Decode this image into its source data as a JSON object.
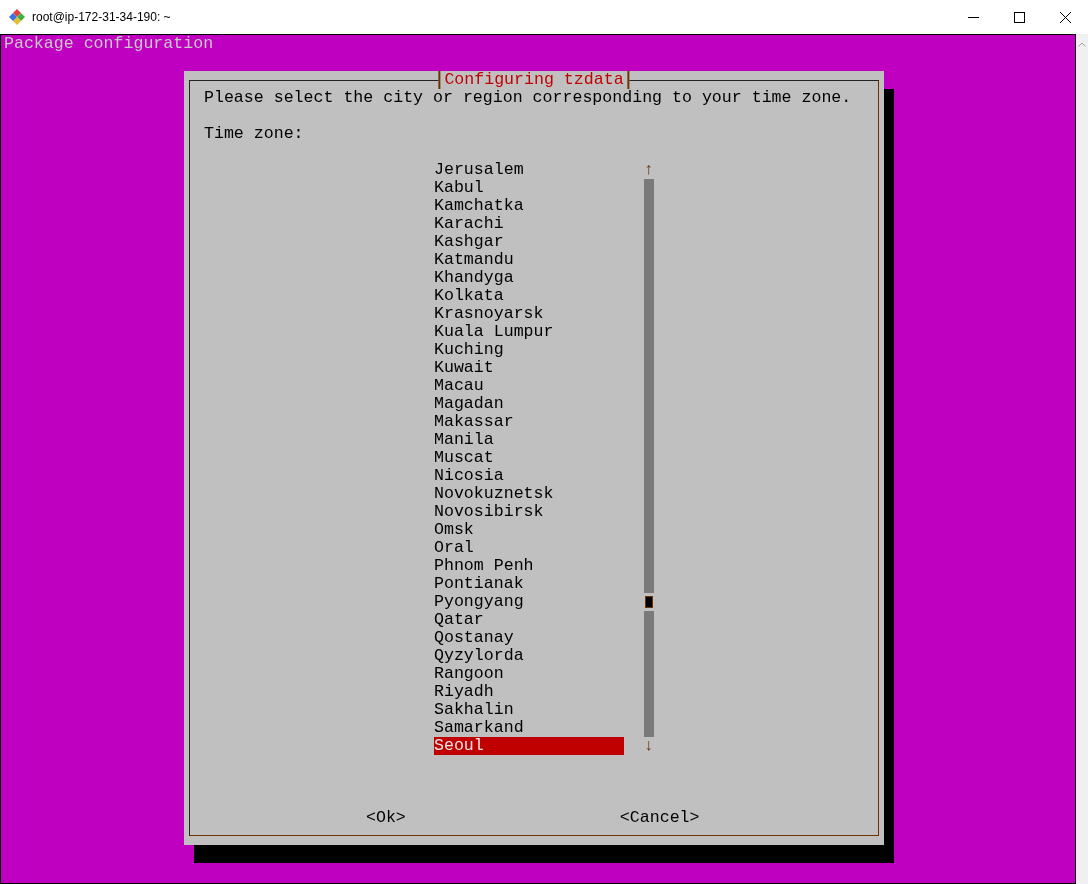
{
  "window": {
    "title": "root@ip-172-31-34-190: ~"
  },
  "terminal": {
    "header": "Package configuration"
  },
  "dialog": {
    "title": "Configuring tzdata",
    "prompt": "Please select the city or region corresponding to your time zone.",
    "list_label": "Time zone:",
    "items": [
      {
        "label": "Jerusalem",
        "selected": false
      },
      {
        "label": "Kabul",
        "selected": false
      },
      {
        "label": "Kamchatka",
        "selected": false
      },
      {
        "label": "Karachi",
        "selected": false
      },
      {
        "label": "Kashgar",
        "selected": false
      },
      {
        "label": "Katmandu",
        "selected": false
      },
      {
        "label": "Khandyga",
        "selected": false
      },
      {
        "label": "Kolkata",
        "selected": false
      },
      {
        "label": "Krasnoyarsk",
        "selected": false
      },
      {
        "label": "Kuala Lumpur",
        "selected": false
      },
      {
        "label": "Kuching",
        "selected": false
      },
      {
        "label": "Kuwait",
        "selected": false
      },
      {
        "label": "Macau",
        "selected": false
      },
      {
        "label": "Magadan",
        "selected": false
      },
      {
        "label": "Makassar",
        "selected": false
      },
      {
        "label": "Manila",
        "selected": false
      },
      {
        "label": "Muscat",
        "selected": false
      },
      {
        "label": "Nicosia",
        "selected": false
      },
      {
        "label": "Novokuznetsk",
        "selected": false
      },
      {
        "label": "Novosibirsk",
        "selected": false
      },
      {
        "label": "Omsk",
        "selected": false
      },
      {
        "label": "Oral",
        "selected": false
      },
      {
        "label": "Phnom Penh",
        "selected": false
      },
      {
        "label": "Pontianak",
        "selected": false
      },
      {
        "label": "Pyongyang",
        "selected": false
      },
      {
        "label": "Qatar",
        "selected": false
      },
      {
        "label": "Qostanay",
        "selected": false
      },
      {
        "label": "Qyzylorda",
        "selected": false
      },
      {
        "label": "Rangoon",
        "selected": false
      },
      {
        "label": "Riyadh",
        "selected": false
      },
      {
        "label": "Sakhalin",
        "selected": false
      },
      {
        "label": "Samarkand",
        "selected": false
      },
      {
        "label": "Seoul",
        "selected": true
      }
    ],
    "scroll_up": "↑",
    "scroll_down": "↓",
    "buttons": [
      "<Ok>",
      "<Cancel>"
    ]
  }
}
